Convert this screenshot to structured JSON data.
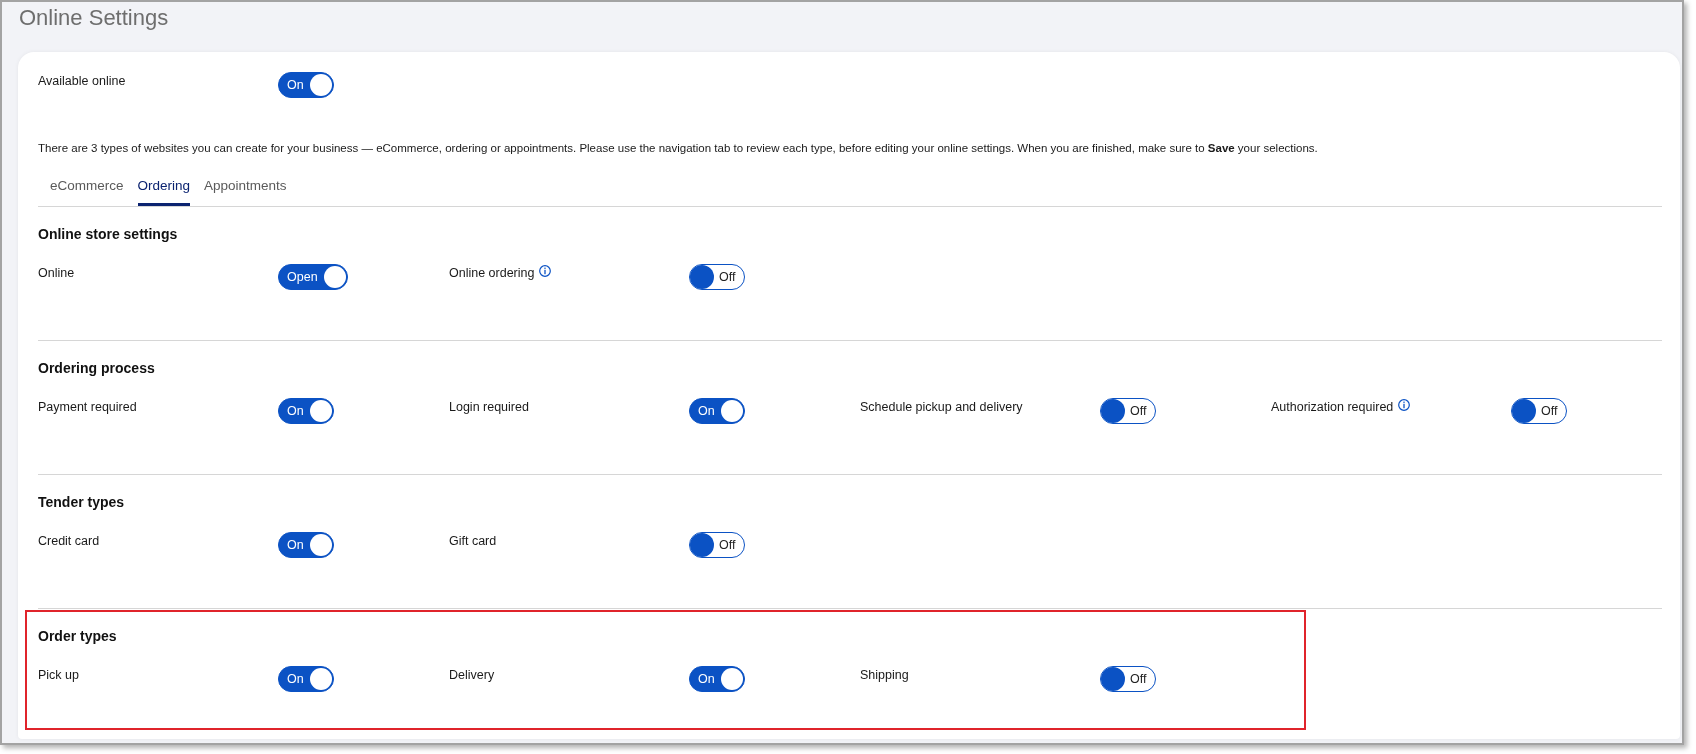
{
  "page": {
    "title": "Online Settings"
  },
  "available_online": {
    "label": "Available online",
    "on": true,
    "state_text": "On"
  },
  "intro": "There are 3 types of websites you can create for your business — eCommerce, ordering or appointments. Please use the navigation tab to review each type, before editing your online settings. When you are finished, make sure to **Save** your selections.",
  "tabs": [
    {
      "label": "eCommerce",
      "selected": false
    },
    {
      "label": "Ordering",
      "selected": true
    },
    {
      "label": "Appointments",
      "selected": false
    }
  ],
  "sections": [
    {
      "title": "Online store settings",
      "highlighted": false,
      "settings": [
        {
          "label": "Online",
          "info": false,
          "on": true,
          "state_text": "Open"
        },
        {
          "label": "Online ordering",
          "info": true,
          "on": false,
          "state_text": "Off"
        }
      ]
    },
    {
      "title": "Ordering process",
      "highlighted": false,
      "settings": [
        {
          "label": "Payment required",
          "info": false,
          "on": true,
          "state_text": "On"
        },
        {
          "label": "Login required",
          "info": false,
          "on": true,
          "state_text": "On"
        },
        {
          "label": "Schedule pickup and delivery",
          "info": false,
          "on": false,
          "state_text": "Off"
        },
        {
          "label": "Authorization required",
          "info": true,
          "on": false,
          "state_text": "Off"
        }
      ]
    },
    {
      "title": "Tender types",
      "highlighted": false,
      "settings": [
        {
          "label": "Credit card",
          "info": false,
          "on": true,
          "state_text": "On"
        },
        {
          "label": "Gift card",
          "info": false,
          "on": false,
          "state_text": "Off"
        }
      ]
    },
    {
      "title": "Order types",
      "highlighted": true,
      "settings": [
        {
          "label": "Pick up",
          "info": false,
          "on": true,
          "state_text": "On"
        },
        {
          "label": "Delivery",
          "info": false,
          "on": true,
          "state_text": "On"
        },
        {
          "label": "Shipping",
          "info": false,
          "on": false,
          "state_text": "Off"
        }
      ]
    }
  ]
}
